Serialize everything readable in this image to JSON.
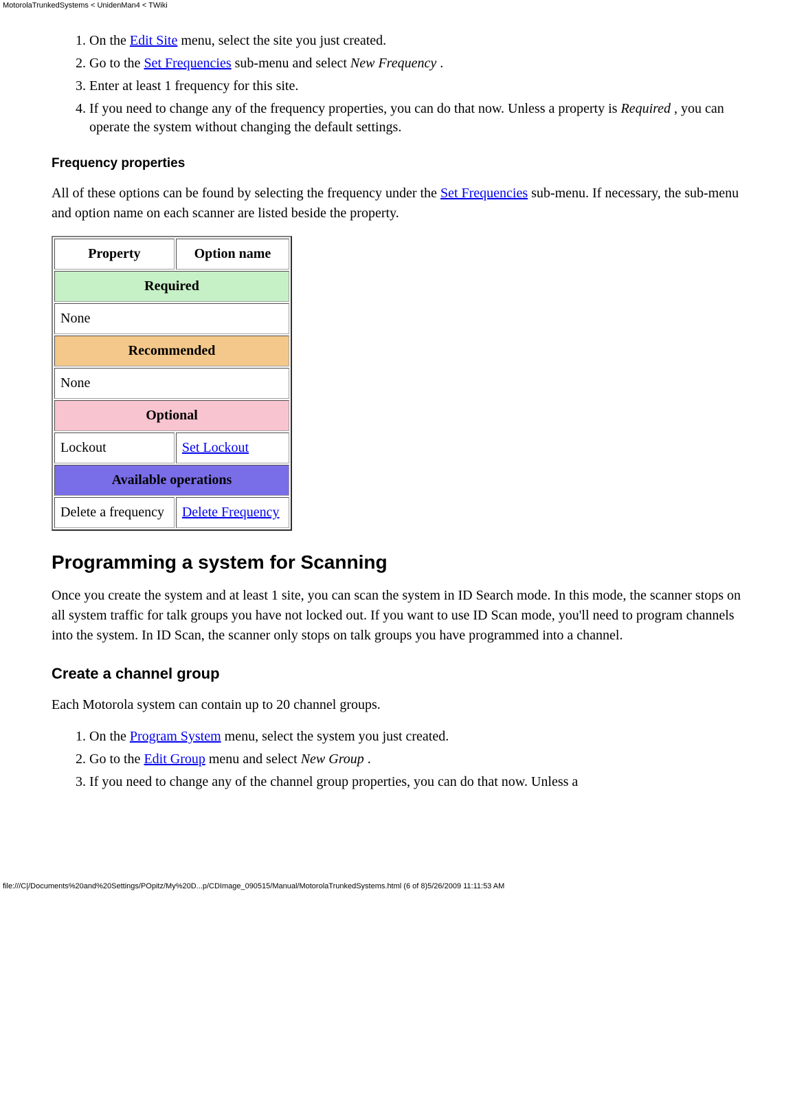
{
  "header_path": "MotorolaTrunkedSystems < UnidenMan4 < TWiki",
  "steps_a": {
    "s1_a": "On the ",
    "s1_link": "Edit Site",
    "s1_b": " menu, select the site you just created.",
    "s2_a": "Go to the ",
    "s2_link": "Set Frequencies",
    "s2_b": " sub-menu and select ",
    "s2_em": "New Frequency",
    "s2_c": " .",
    "s3": "Enter at least 1 frequency for this site.",
    "s4_a": "If you need to change any of the frequency properties, you can do that now. Unless a property is ",
    "s4_em": "Required",
    "s4_b": " , you can operate the system without changing the default settings."
  },
  "freq_heading": "Frequency properties",
  "freq_para_a": "All of these options can be found by selecting the frequency under the ",
  "freq_para_link": "Set Frequencies",
  "freq_para_b": " sub-menu. If necessary, the sub-menu and option name on each scanner are listed beside the property.",
  "table": {
    "h1": "Property",
    "h2": "Option name",
    "required": "Required",
    "none1": "None",
    "recommended": "Recommended",
    "none2": "None",
    "optional": "Optional",
    "lockout": "Lockout",
    "set_lockout": "Set Lockout",
    "avail": "Available operations",
    "del_freq": "Delete a frequency",
    "del_freq_link": "Delete Frequency"
  },
  "prog_heading": "Programming a system for Scanning",
  "prog_para": "Once you create the system and at least 1 site, you can scan the system in ID Search mode. In this mode, the scanner stops on all system traffic for talk groups you have not locked out. If you want to use ID Scan mode, you'll need to program channels into the system. In ID Scan, the scanner only stops on talk groups you have programmed into a channel.",
  "chan_heading": "Create a channel group",
  "chan_para": "Each Motorola system can contain up to 20 channel groups.",
  "steps_b": {
    "s1_a": "On the ",
    "s1_link": "Program System",
    "s1_b": " menu, select the system you just created.",
    "s2_a": "Go to the ",
    "s2_link": "Edit Group",
    "s2_b": " menu and select ",
    "s2_em": "New Group",
    "s2_c": " .",
    "s3": "If you need to change any of the channel group properties, you can do that now. Unless a"
  },
  "footer": "file:///C|/Documents%20and%20Settings/POpitz/My%20D...p/CDImage_090515/Manual/MotorolaTrunkedSystems.html (6 of 8)5/26/2009 11:11:53 AM"
}
